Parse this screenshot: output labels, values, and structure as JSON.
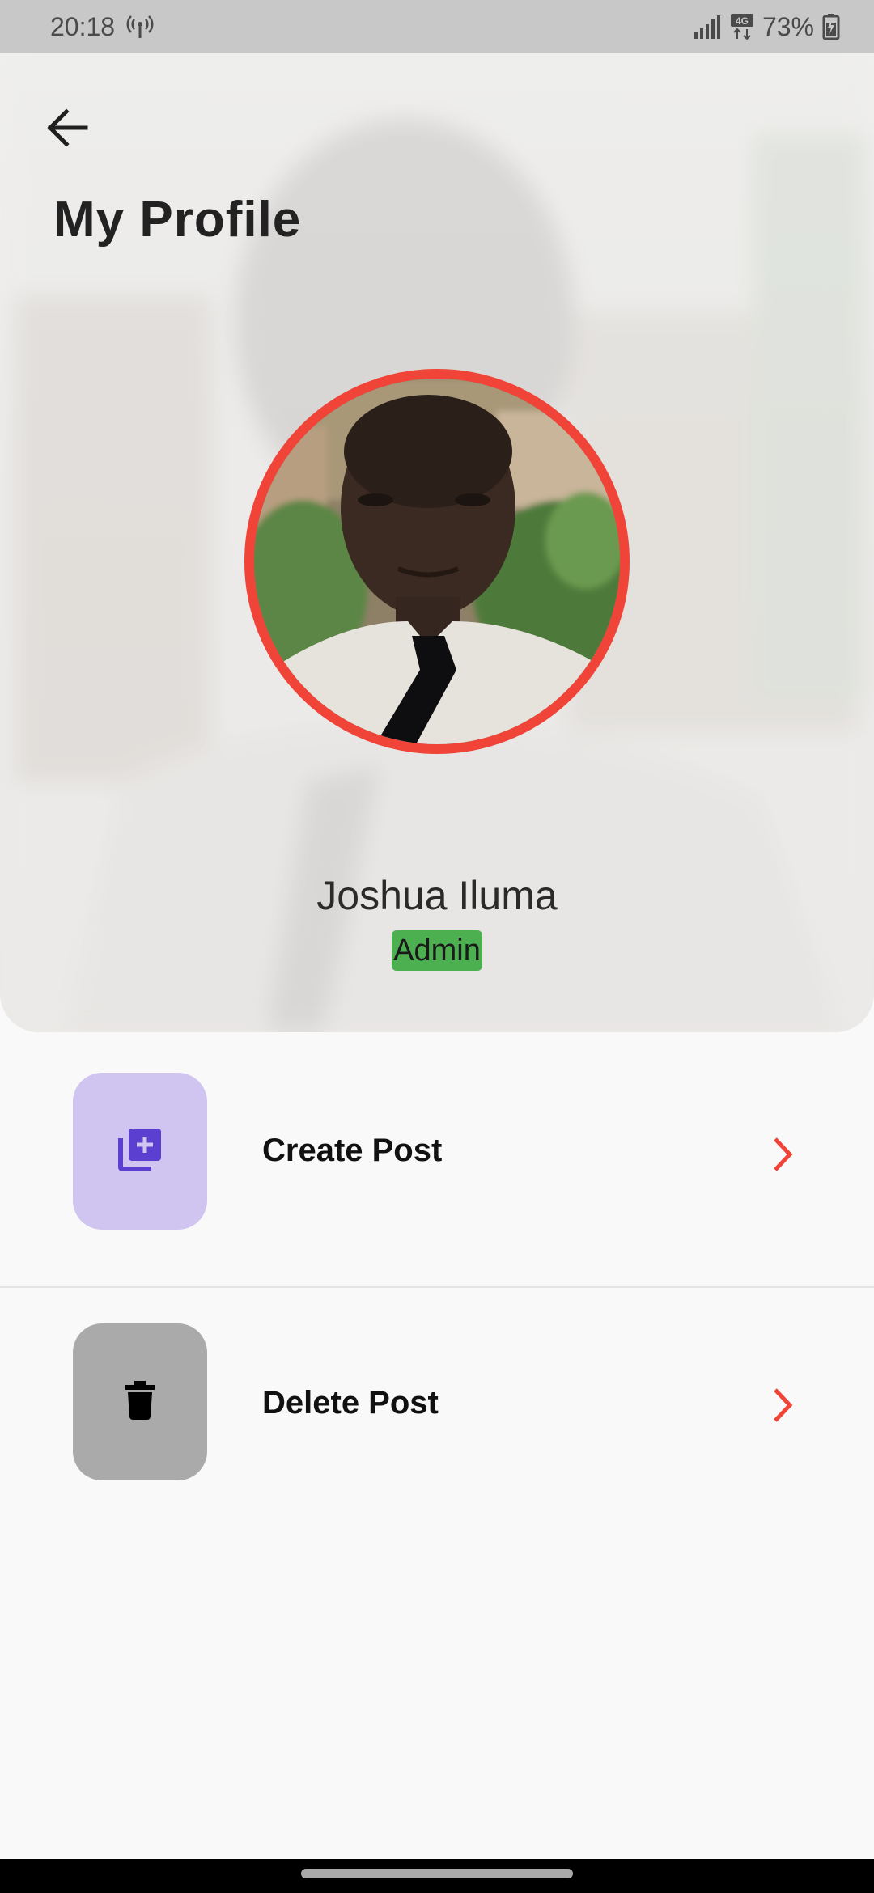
{
  "status_bar": {
    "time": "20:18",
    "network": "4G",
    "battery": "73%"
  },
  "header": {
    "title": "My Profile",
    "back_icon": "arrow-back-icon"
  },
  "profile": {
    "name": "Joshua Iluma",
    "role": "Admin"
  },
  "actions": [
    {
      "label": "Create Post",
      "icon": "library-add-icon",
      "tile_color": "#cfc5f0",
      "icon_color": "#5b3fd1"
    },
    {
      "label": "Delete Post",
      "icon": "trash-icon",
      "tile_color": "#aaaaaa",
      "icon_color": "#000000"
    }
  ],
  "colors": {
    "accent_red": "#f04438",
    "badge_green": "#4caf50"
  }
}
